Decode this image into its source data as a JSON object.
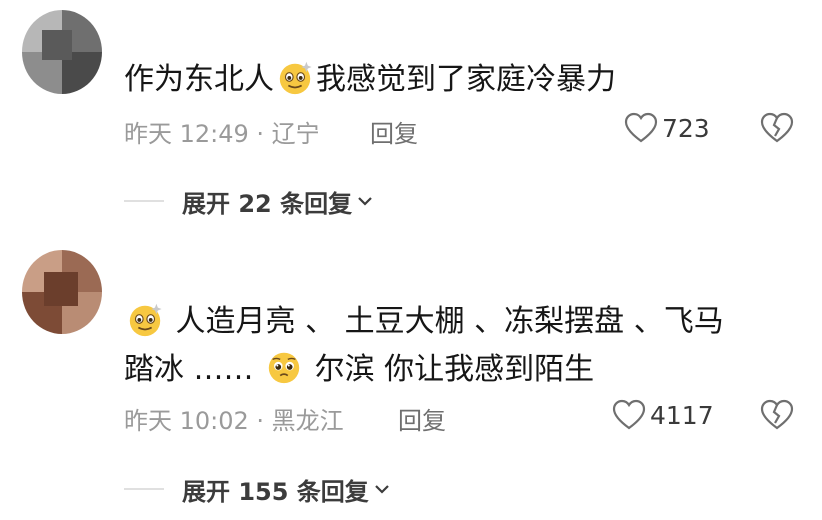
{
  "comments": [
    {
      "text_before": "作为东北人",
      "emoji_1": "smiling-face-with-sparkle-emoji",
      "text_after": "我感觉到了家庭冷暴力",
      "time": "昨天 12:49 · 辽宁",
      "reply_label": "回复",
      "like_count": "723",
      "expand_label": "展开 22 条回复"
    },
    {
      "emoji_1": "smiling-face-with-sparkle-emoji",
      "line1": "人造月亮 、 土豆大棚 、冻梨摆盘 、飞马",
      "line2_a": "踏冰 ……",
      "emoji_2": "pleading-face-emoji",
      "line2_b": "尔滨 你让我感到陌生",
      "time": "昨天 10:02 · 黑龙江",
      "reply_label": "回复",
      "like_count": "4117",
      "expand_label": "展开 155 条回复"
    }
  ],
  "colors": {
    "text": "#161616",
    "meta": "#9a9a9a",
    "emoji_yellow": "#f7c841"
  }
}
